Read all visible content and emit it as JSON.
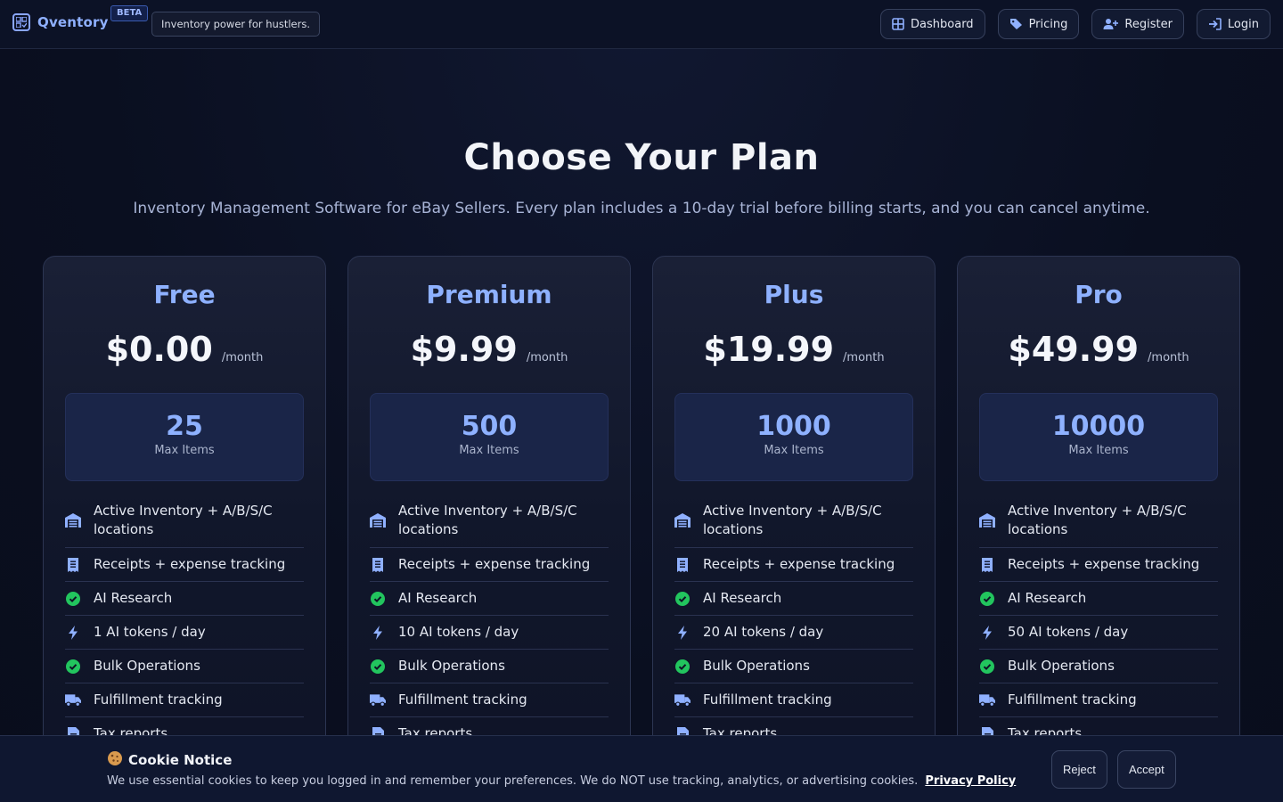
{
  "navbar": {
    "brand": "Qventory",
    "beta": "BETA",
    "tagline": "Inventory power for hustlers.",
    "links": [
      {
        "label": "Dashboard",
        "icon": "dashboard-icon"
      },
      {
        "label": "Pricing",
        "icon": "tag-icon"
      },
      {
        "label": "Register",
        "icon": "user-plus-icon"
      },
      {
        "label": "Login",
        "icon": "login-icon"
      }
    ]
  },
  "hero": {
    "title": "Choose Your Plan",
    "subtitle": "Inventory Management Software for eBay Sellers. Every plan includes a 10-day trial before billing starts, and you can cancel anytime."
  },
  "plans": [
    {
      "name": "Free",
      "price": "$0.00",
      "period": "/month",
      "max_items": "25",
      "max_label": "Max Items",
      "features": [
        "Active Inventory + A/B/S/C locations",
        "Receipts + expense tracking",
        "AI Research",
        "1 AI tokens / day",
        "Bulk Operations",
        "Fulfillment tracking",
        "Tax reports"
      ]
    },
    {
      "name": "Premium",
      "price": "$9.99",
      "period": "/month",
      "max_items": "500",
      "max_label": "Max Items",
      "features": [
        "Active Inventory + A/B/S/C locations",
        "Receipts + expense tracking",
        "AI Research",
        "10 AI tokens / day",
        "Bulk Operations",
        "Fulfillment tracking",
        "Tax reports"
      ]
    },
    {
      "name": "Plus",
      "price": "$19.99",
      "period": "/month",
      "max_items": "1000",
      "max_label": "Max Items",
      "features": [
        "Active Inventory + A/B/S/C locations",
        "Receipts + expense tracking",
        "AI Research",
        "20 AI tokens / day",
        "Bulk Operations",
        "Fulfillment tracking",
        "Tax reports"
      ]
    },
    {
      "name": "Pro",
      "price": "$49.99",
      "period": "/month",
      "max_items": "10000",
      "max_label": "Max Items",
      "features": [
        "Active Inventory + A/B/S/C locations",
        "Receipts + expense tracking",
        "AI Research",
        "50 AI tokens / day",
        "Bulk Operations",
        "Fulfillment tracking",
        "Tax reports"
      ]
    }
  ],
  "feature_icons": [
    "warehouse-icon",
    "receipt-icon",
    "check-circle-icon",
    "bolt-icon",
    "check-circle-icon",
    "truck-icon",
    "tax-report-icon"
  ],
  "cookie": {
    "icon": "cookie-icon",
    "title": "Cookie Notice",
    "text": "We use essential cookies to keep you logged in and remember your preferences. We do NOT use tracking, analytics, or advertising cookies.",
    "link": "Privacy Policy",
    "reject": "Reject",
    "accept": "Accept"
  },
  "colors": {
    "accent": "#8eb1ff",
    "background": "#0b1022",
    "success": "#22c55e"
  }
}
